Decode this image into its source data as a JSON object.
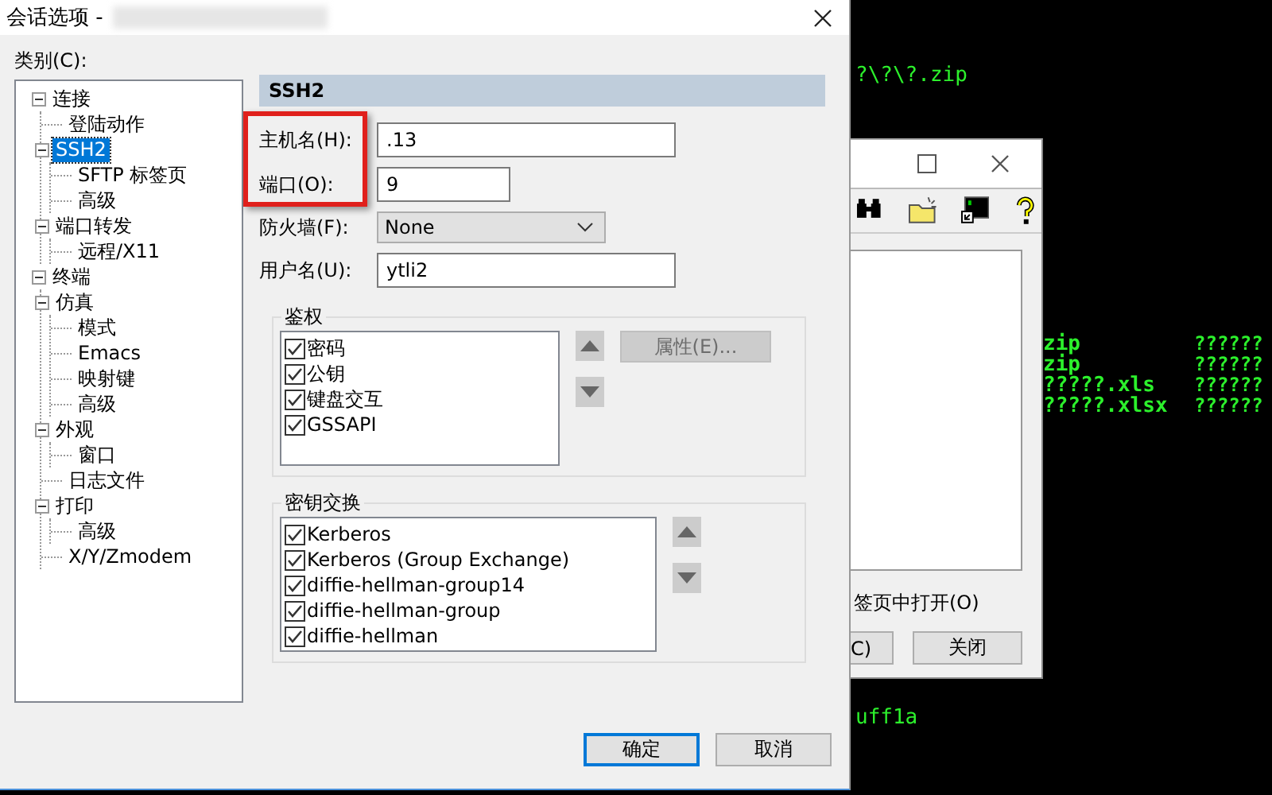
{
  "terminal": {
    "top_line": "?\\?\\?.zip",
    "rows": [
      {
        "cells": [
          "zip",
          "??????"
        ]
      },
      {
        "cells": [
          "zip",
          "??????"
        ]
      },
      {
        "cells": [
          "?????.xls",
          "??????"
        ]
      },
      {
        "cells": [
          "?????.xlsx",
          "??????"
        ]
      }
    ],
    "bottom_line": "uff1a"
  },
  "back_window": {
    "option_text": "签页中打开(O)",
    "buttons": [
      "C)",
      "关闭"
    ]
  },
  "dialog": {
    "title": "会话选项 -",
    "category_label": "类别(C):",
    "tree": [
      {
        "label": "连接",
        "expanded": true,
        "selected": false,
        "children": [
          {
            "label": "登陆动作",
            "selected": false
          },
          {
            "label": "SSH2",
            "expanded": true,
            "selected": true,
            "children": [
              {
                "label": "SFTP 标签页",
                "selected": false
              },
              {
                "label": "高级",
                "selected": false
              }
            ]
          },
          {
            "label": "端口转发",
            "expanded": true,
            "selected": false,
            "children": [
              {
                "label": "远程/X11",
                "selected": false
              }
            ]
          }
        ]
      },
      {
        "label": "终端",
        "expanded": true,
        "selected": false,
        "children": [
          {
            "label": "仿真",
            "expanded": true,
            "selected": false,
            "children": [
              {
                "label": "模式",
                "selected": false
              },
              {
                "label": "Emacs",
                "selected": false
              },
              {
                "label": "映射键",
                "selected": false
              },
              {
                "label": "高级",
                "selected": false
              }
            ]
          },
          {
            "label": "外观",
            "expanded": true,
            "selected": false,
            "children": [
              {
                "label": "窗口",
                "selected": false
              }
            ]
          },
          {
            "label": "日志文件",
            "selected": false
          },
          {
            "label": "打印",
            "expanded": true,
            "selected": false,
            "children": [
              {
                "label": "高级",
                "selected": false
              }
            ]
          },
          {
            "label": "X/Y/Zmodem",
            "selected": false
          }
        ]
      }
    ],
    "section_title": "SSH2",
    "fields": [
      {
        "kind": "text",
        "label": "主机名(H):",
        "value": ".13"
      },
      {
        "kind": "text",
        "label": "端口(O):",
        "value": "9"
      },
      {
        "kind": "select",
        "label": "防火墙(F):",
        "value": "None"
      },
      {
        "kind": "text",
        "label": "用户名(U):",
        "value": "ytli2"
      }
    ],
    "auth": {
      "title": "鉴权",
      "items": [
        {
          "label": "密码",
          "checked": true
        },
        {
          "label": "公钥",
          "checked": true
        },
        {
          "label": "键盘交互",
          "checked": true
        },
        {
          "label": "GSSAPI",
          "checked": true
        }
      ],
      "properties_button": {
        "label": "属性(E)...",
        "disabled": true
      }
    },
    "kex": {
      "title": "密钥交换",
      "items": [
        {
          "label": "Kerberos",
          "checked": true
        },
        {
          "label": "Kerberos (Group Exchange)",
          "checked": true
        },
        {
          "label": "diffie-hellman-group14",
          "checked": true
        },
        {
          "label": "diffie-hellman-group",
          "checked": true
        },
        {
          "label": "diffie-hellman",
          "checked": true
        }
      ]
    },
    "buttons": [
      {
        "label": "确定",
        "default": true
      },
      {
        "label": "取消",
        "default": false
      }
    ]
  }
}
